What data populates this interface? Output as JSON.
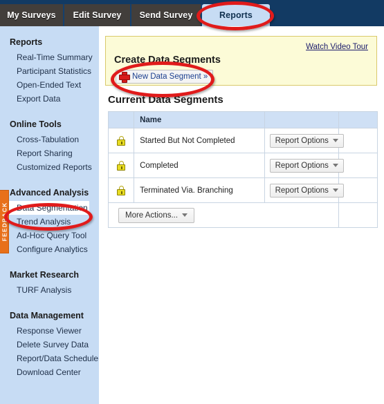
{
  "topnav": {
    "tabs": [
      {
        "label": "My Surveys",
        "active": false
      },
      {
        "label": "Edit Survey",
        "active": false
      },
      {
        "label": "Send Survey",
        "active": false
      },
      {
        "label": "Reports",
        "active": true
      }
    ]
  },
  "feedback": {
    "label": "FEEDBACK"
  },
  "sidebar": {
    "groups": [
      {
        "heading": "Reports",
        "items": [
          {
            "label": "Real-Time Summary",
            "selected": false
          },
          {
            "label": "Participant Statistics",
            "selected": false
          },
          {
            "label": "Open-Ended Text",
            "selected": false
          },
          {
            "label": "Export Data",
            "selected": false
          }
        ]
      },
      {
        "heading": "Online Tools",
        "items": [
          {
            "label": "Cross-Tabulation",
            "selected": false
          },
          {
            "label": "Report Sharing",
            "selected": false
          },
          {
            "label": "Customized Reports",
            "selected": false
          }
        ]
      },
      {
        "heading": "Advanced Analysis",
        "items": [
          {
            "label": "Data Segmentation",
            "selected": true
          },
          {
            "label": "Trend Analysis",
            "selected": false
          },
          {
            "label": "Ad-Hoc Query Tool",
            "selected": false
          },
          {
            "label": "Configure Analytics",
            "selected": false
          }
        ]
      },
      {
        "heading": "Market Research",
        "items": [
          {
            "label": "TURF Analysis",
            "selected": false
          }
        ]
      },
      {
        "heading": "Data Management",
        "items": [
          {
            "label": "Response Viewer",
            "selected": false
          },
          {
            "label": "Delete Survey Data",
            "selected": false
          },
          {
            "label": "Report/Data Scheduler",
            "selected": false
          },
          {
            "label": "Download Center",
            "selected": false
          }
        ]
      }
    ]
  },
  "promo": {
    "title": "Create Data Segments",
    "watch_video_label": "Watch Video Tour",
    "new_segment_label": "New Data Segment »",
    "plus_icon": "plus-icon"
  },
  "segments_section": {
    "title": "Current Data Segments",
    "columns": [
      "",
      "Name",
      "",
      ""
    ],
    "rows": [
      {
        "lock_icon": "lock-icon",
        "name": "Started But Not Completed",
        "action_label": "Report Options",
        "blank": ""
      },
      {
        "lock_icon": "lock-icon",
        "name": "Completed",
        "action_label": "Report Options",
        "blank": ""
      },
      {
        "lock_icon": "lock-icon",
        "name": "Terminated Via. Branching",
        "action_label": "Report Options",
        "blank": ""
      }
    ],
    "more_actions_label": "More Actions..."
  },
  "annotations": {
    "reports_tab_circle": "red-ellipse",
    "new_segment_circle": "red-ellipse",
    "data_segmentation_circle": "red-ellipse"
  },
  "colors": {
    "topbar_navy": "#123a63",
    "tab_inactive": "#423e3b",
    "tab_active": "#c7dcf4",
    "sidebar_bg": "#c7dcf4",
    "promo_bg": "#fcfbd7",
    "promo_border": "#d9c96b",
    "annotation_red": "#e01b1b",
    "feedback_orange": "#e8701a",
    "table_header": "#cfe0f5",
    "link_blue": "#1b3f8f"
  }
}
